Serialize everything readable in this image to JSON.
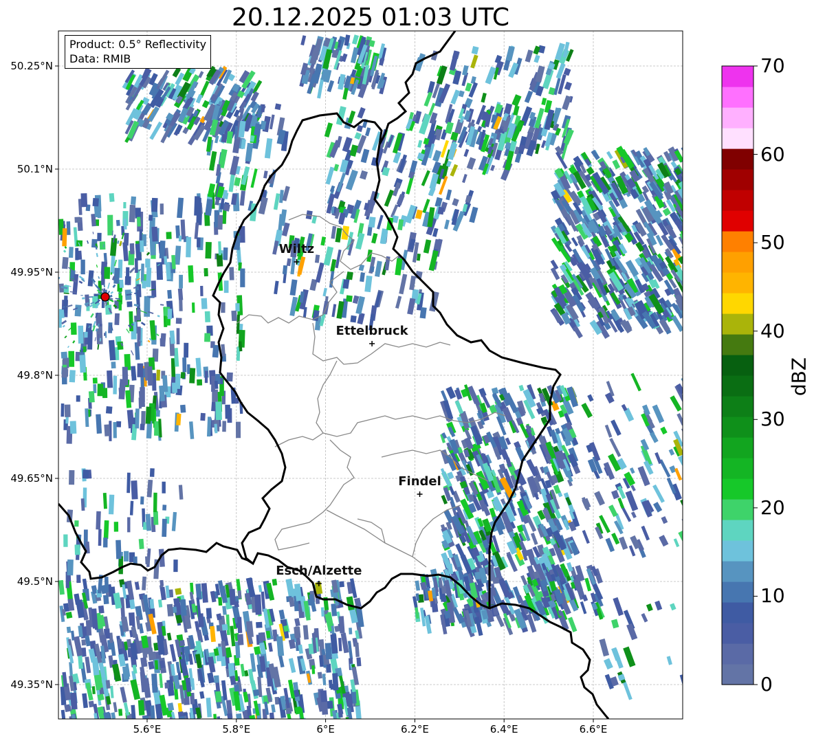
{
  "title": "20.12.2025 01:03 UTC",
  "info": {
    "product": "Product: 0.5° Reflectivity",
    "source": "Data: RMIB"
  },
  "lat_ticks": [
    {
      "label": "50.25°N",
      "value": 50.25
    },
    {
      "label": "50.1°N",
      "value": 50.1
    },
    {
      "label": "49.95°N",
      "value": 49.95
    },
    {
      "label": "49.8°N",
      "value": 49.8
    },
    {
      "label": "49.65°N",
      "value": 49.65
    },
    {
      "label": "49.5°N",
      "value": 49.5
    },
    {
      "label": "49.35°N",
      "value": 49.35
    }
  ],
  "lon_ticks": [
    {
      "label": "5.6°E",
      "value": 5.6
    },
    {
      "label": "5.8°E",
      "value": 5.8
    },
    {
      "label": "6°E",
      "value": 6.0
    },
    {
      "label": "6.2°E",
      "value": 6.2
    },
    {
      "label": "6.4°E",
      "value": 6.4
    },
    {
      "label": "6.6°E",
      "value": 6.6
    }
  ],
  "map_extent": {
    "lon": [
      5.4,
      6.8
    ],
    "lat": [
      49.3,
      50.3
    ]
  },
  "cities": [
    {
      "name": "Wiltz",
      "lon": 5.935,
      "lat": 49.965
    },
    {
      "name": "Ettelbruck",
      "lon": 6.104,
      "lat": 49.846
    },
    {
      "name": "Findel",
      "lon": 6.211,
      "lat": 49.627
    },
    {
      "name": "Esch/Alzette",
      "lon": 5.985,
      "lat": 49.497
    }
  ],
  "radar_site": {
    "lon": 5.506,
    "lat": 49.914,
    "color": "#e00000"
  },
  "colorbar": {
    "label": "dBZ",
    "min": 0,
    "max": 70,
    "ticks": [
      {
        "label": "0",
        "value": 0
      },
      {
        "label": "10",
        "value": 10
      },
      {
        "label": "20",
        "value": 20
      },
      {
        "label": "30",
        "value": 30
      },
      {
        "label": "40",
        "value": 40
      },
      {
        "label": "50",
        "value": 50
      },
      {
        "label": "60",
        "value": 60
      },
      {
        "label": "70",
        "value": 70
      }
    ],
    "colors": [
      "#6374a6",
      "#5a6aa6",
      "#4a5da4",
      "#3f5ba3",
      "#4776b0",
      "#5794c0",
      "#6ec2dc",
      "#5ed5c0",
      "#3ed36a",
      "#16c829",
      "#14b524",
      "#12a51f",
      "#0f901a",
      "#0d7f17",
      "#0a6e13",
      "#076010",
      "#457a10",
      "#aab40a",
      "#ffd700",
      "#ffb400",
      "#ffa000",
      "#ff8000",
      "#e00000",
      "#c00000",
      "#a00000",
      "#800000",
      "#ffe0ff",
      "#ffb0ff",
      "#ff70ff",
      "#ee33ee"
    ]
  }
}
